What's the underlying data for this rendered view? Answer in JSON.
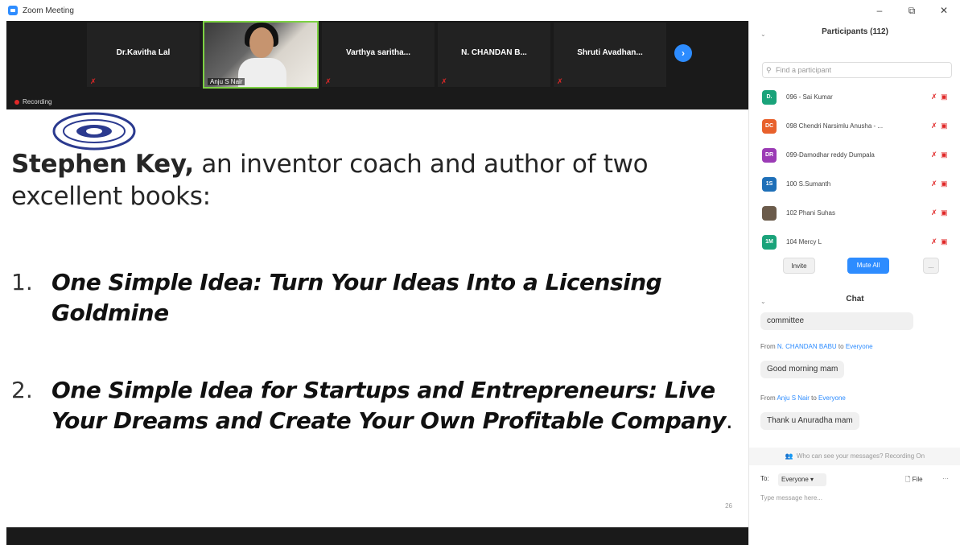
{
  "window": {
    "title": "Zoom Meeting",
    "controls": [
      "–",
      "⧉",
      "✕"
    ]
  },
  "video_strip": {
    "tiles": [
      {
        "name": "Dr.Kavitha Lal"
      },
      {
        "name": "Anju S Nair",
        "has_video": true
      },
      {
        "name": "Varthya saritha..."
      },
      {
        "name": "N. CHANDAN B..."
      },
      {
        "name": "Shruti Avadhan..."
      }
    ],
    "next_icon": "chevron-right-icon",
    "next_glyph": "›",
    "recording_label": "Recording"
  },
  "slide": {
    "heading_bold": "Stephen Key,",
    "heading_rest": " an inventor coach and author of two excellent books:",
    "books": [
      {
        "num": "1.",
        "title": "One Simple Idea: Turn Your Ideas Into a Licensing Goldmine",
        "after": ""
      },
      {
        "num": "2.",
        "title": " One Simple Idea for Startups and Entrepreneurs: Live Your Dreams and Create Your Own Profitable Company",
        "after": "."
      }
    ],
    "page_number": "26"
  },
  "participants_panel": {
    "title": "Participants (112)",
    "search_placeholder": "Find a participant",
    "participants": [
      {
        "initials": "D.",
        "name": "096 - Sai Kumar",
        "color": "#1aa37a"
      },
      {
        "initials": "DC",
        "name": "098 Chendri Narsimlu Anusha - ...",
        "color": "#e8612c"
      },
      {
        "initials": "DR",
        "name": "099-Damodhar reddy Dumpala",
        "color": "#9b3bb5"
      },
      {
        "initials": "1S",
        "name": "100 S.Sumanth",
        "color": "#1e6fb8"
      },
      {
        "initials": "",
        "name": "102 Phani Suhas",
        "color": "#6b5b4b"
      },
      {
        "initials": "1M",
        "name": "104 Mercy L",
        "color": "#1aa37a"
      }
    ],
    "buttons": {
      "invite": "Invite",
      "mute_all": "Mute All",
      "more": "..."
    }
  },
  "chat_panel": {
    "title": "Chat",
    "messages": [
      {
        "text": "committee"
      },
      {
        "from_prefix": "From ",
        "sender": "N. CHANDAN BABU",
        "to_prefix": " to ",
        "recipient": "Everyone",
        "text": "Good morning mam"
      },
      {
        "from_prefix": "From ",
        "sender": "Anju S Nair",
        "to_prefix": " to ",
        "recipient": "Everyone",
        "text": "Thank u Anuradha mam"
      }
    ],
    "privacy_note": "Who can see your messages? Recording On",
    "to_label": "To:",
    "recipient_select": "Everyone ▾",
    "file_label": "File",
    "input_placeholder": "Type message here..."
  },
  "colors": {
    "accent": "#2d8cff",
    "muted_red": "#e02828",
    "active_speaker": "#7cd142"
  }
}
